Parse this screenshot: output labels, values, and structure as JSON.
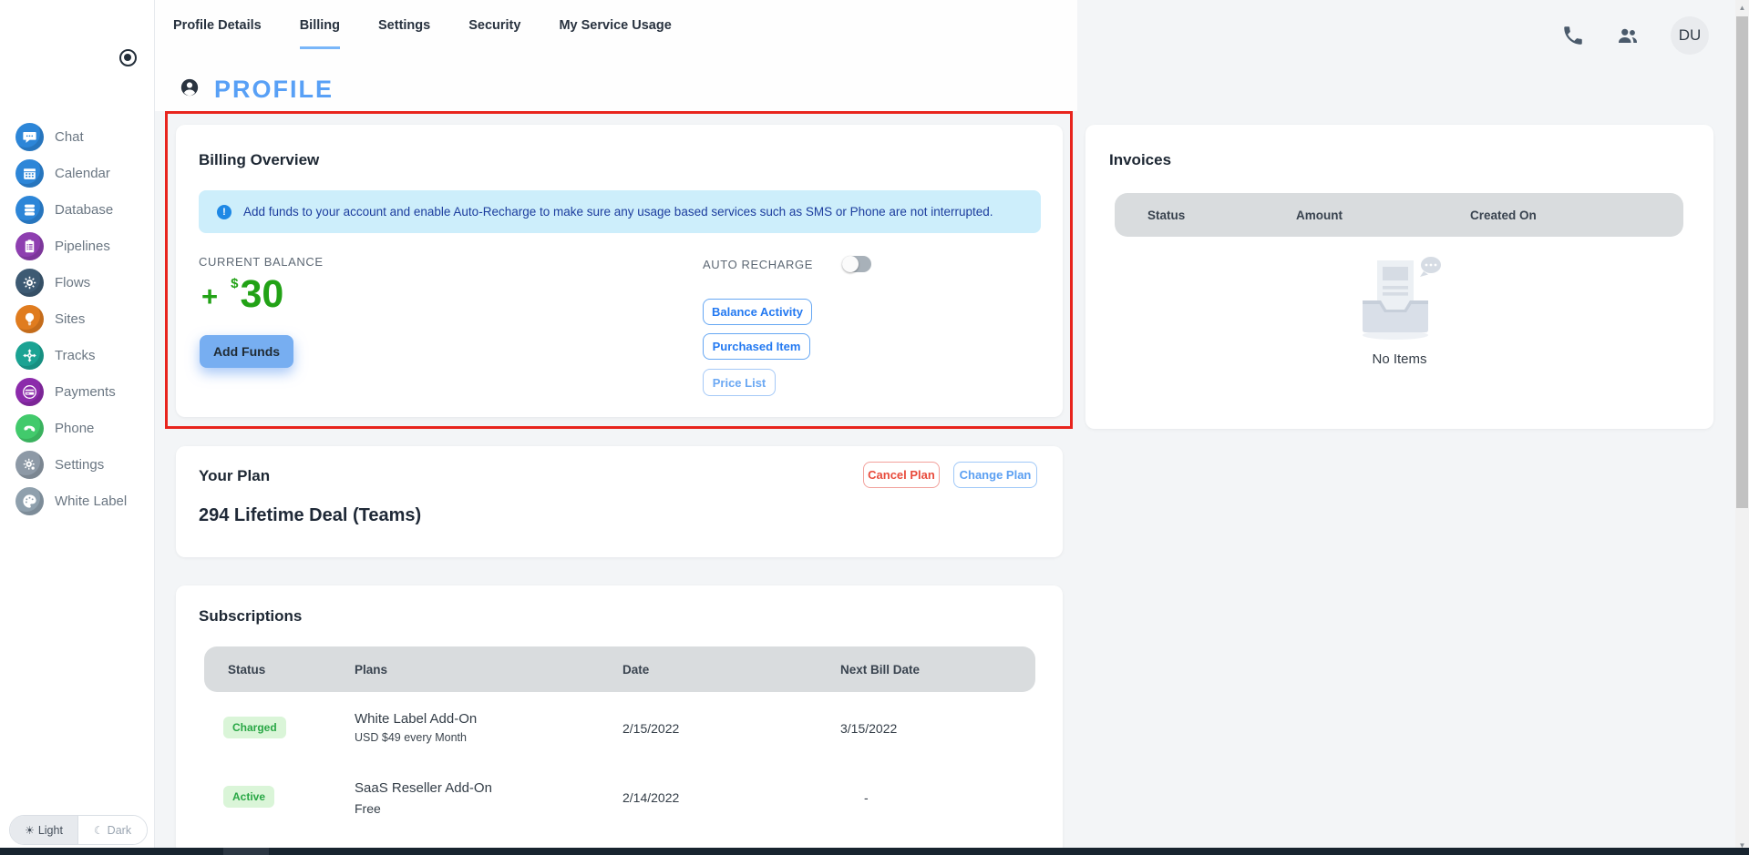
{
  "tabs": {
    "items": [
      {
        "label": "Profile Details",
        "active": false
      },
      {
        "label": "Billing",
        "active": true
      },
      {
        "label": "Settings",
        "active": false
      },
      {
        "label": "Security",
        "active": false
      },
      {
        "label": "My Service Usage",
        "active": false
      }
    ]
  },
  "topbar": {
    "avatar_initials": "DU"
  },
  "page": {
    "title": "PROFILE"
  },
  "sidebar": {
    "items": [
      {
        "label": "Chat",
        "color": "#2d86d8"
      },
      {
        "label": "Calendar",
        "color": "#2d86d8"
      },
      {
        "label": "Database",
        "color": "#2d86d8"
      },
      {
        "label": "Pipelines",
        "color": "#8e3fb0"
      },
      {
        "label": "Flows",
        "color": "#3d5a73"
      },
      {
        "label": "Sites",
        "color": "#e07c1f"
      },
      {
        "label": "Tracks",
        "color": "#1ba393"
      },
      {
        "label": "Payments",
        "color": "#8c2bab"
      },
      {
        "label": "Phone",
        "color": "#42ca6c"
      },
      {
        "label": "Settings",
        "color": "#8d99a6"
      },
      {
        "label": "White Label",
        "color": "#8fa0ad"
      }
    ],
    "theme_toggle": {
      "light": "Light",
      "dark": "Dark",
      "sun": "☀",
      "moon": "☾"
    }
  },
  "billing_overview": {
    "title": "Billing Overview",
    "alert_icon": "!",
    "alert": "Add funds to your account and enable Auto-Recharge to make sure any usage based services such as SMS or Phone are not interrupted.",
    "current_balance_label": "CURRENT BALANCE",
    "balance_sign": "+",
    "balance_currency": "$",
    "balance_amount": "30",
    "add_funds_label": "Add Funds",
    "auto_recharge_label": "AUTO RECHARGE",
    "auto_recharge_state": "off",
    "buttons": {
      "balance_activity": "Balance Activity",
      "purchased_item": "Purchased Item",
      "price_list": "Price List"
    }
  },
  "invoices": {
    "title": "Invoices",
    "columns": [
      "Status",
      "Amount",
      "Created On"
    ],
    "empty_text": "No Items"
  },
  "your_plan": {
    "title": "Your Plan",
    "plan_name": "294 Lifetime Deal (Teams)",
    "cancel_label": "Cancel Plan",
    "change_label": "Change Plan"
  },
  "subscriptions": {
    "title": "Subscriptions",
    "columns": [
      "Status",
      "Plans",
      "Date",
      "Next Bill Date"
    ],
    "rows": [
      {
        "status": "Charged",
        "plan": "White Label Add-On",
        "plan_detail": "USD $49 every Month",
        "date": "2/15/2022",
        "next_bill_date": "3/15/2022"
      },
      {
        "status": "Active",
        "plan": "SaaS Reseller Add-On",
        "plan_detail": "Free",
        "date": "2/14/2022",
        "next_bill_date": "-"
      }
    ]
  },
  "colors": {
    "accent_blue": "#58a0f6",
    "tab_underline": "#79b6f9",
    "balance_green": "#22a216",
    "alert_bg": "#cdeefb",
    "alert_text": "#1c3d9e",
    "highlight_red": "#e8241d",
    "badge_green_bg": "#daf5d8",
    "badge_green_text": "#29a745",
    "table_head_bg": "#d9dcde",
    "add_funds_bg": "#77aef1"
  }
}
